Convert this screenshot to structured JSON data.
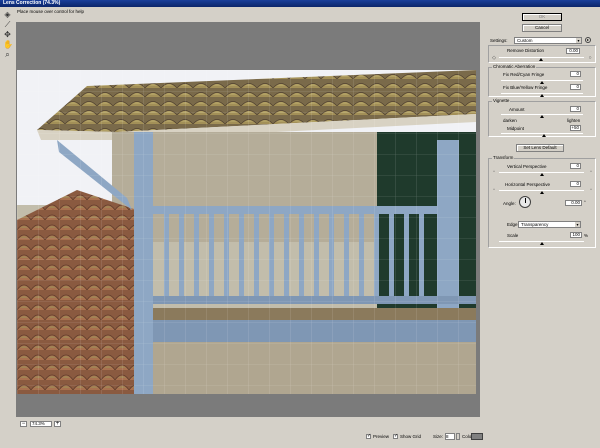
{
  "window": {
    "title": "Lens Correction (74.3%)",
    "hint": "Place mouse over control for help"
  },
  "tools": [
    {
      "name": "remove-distortion-tool-icon",
      "glyph": "◈"
    },
    {
      "name": "straighten-tool-icon",
      "glyph": "⟋"
    },
    {
      "name": "move-grid-tool-icon",
      "glyph": "✥"
    },
    {
      "name": "hand-tool-icon",
      "glyph": "✋"
    },
    {
      "name": "zoom-tool-icon",
      "glyph": "⌕"
    }
  ],
  "zoom": {
    "minus": "−",
    "value": "74.3%",
    "plus": "+"
  },
  "view_options": {
    "preview_label": "Preview",
    "preview_checked": "✓",
    "show_grid_label": "Show Grid",
    "show_grid_checked": "✓",
    "size_label": "Size:",
    "size_value": "8",
    "color_label": "Color:",
    "color_hex": "#808080"
  },
  "buttons": {
    "ok": "OK",
    "cancel": "Cancel"
  },
  "settings": {
    "label": "Settings:",
    "value": "Custom",
    "menu_icon": "▸"
  },
  "remove_distortion": {
    "label": "Remove Distortion",
    "value": "0.00",
    "level": 0.5
  },
  "chromatic_aberration": {
    "title": "Chromatic Aberration",
    "red_cyan_label": "Fix Red/Cyan Fringe",
    "red_cyan_value": "0",
    "blue_yellow_label": "Fix Blue/Yellow Fringe",
    "blue_yellow_value": "0"
  },
  "vignette": {
    "title": "Vignette",
    "amount_label": "Amount",
    "amount_value": "0",
    "darken_label": "darken",
    "lighten_label": "lighten",
    "midpoint_label": "Midpoint",
    "midpoint_value": "+50"
  },
  "set_lens_default": "Set Lens Default",
  "transform": {
    "title": "Transform",
    "vertical_label": "Vertical Perspective",
    "vertical_value": "0",
    "horizontal_label": "Horizontal Perspective",
    "horizontal_value": "0",
    "angle_label": "Angle:",
    "angle_value": "0.00",
    "angle_unit": "°",
    "edge_label": "Edge:",
    "edge_value": "Transparency",
    "scale_label": "Scale",
    "scale_value": "100",
    "scale_unit": "%"
  },
  "colors": {
    "canvas": "#7b7b7b",
    "dialog": "#d4d0c8",
    "titlebar": "#0a246a"
  }
}
